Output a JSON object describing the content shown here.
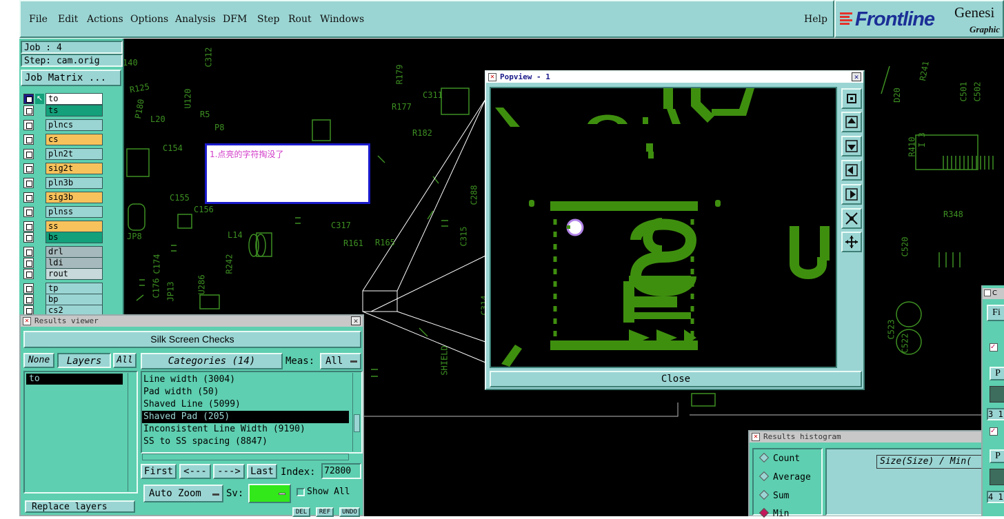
{
  "menu": {
    "items": [
      "File",
      "Edit",
      "Actions",
      "Options",
      "Analysis",
      "DFM",
      "Step",
      "Rout",
      "Windows"
    ],
    "help": "Help"
  },
  "logo": {
    "brand": "Frontline",
    "product": "Genesi",
    "sub": "Graphic"
  },
  "job": {
    "job_label": "Job : 4",
    "step_label": "Step: cam.orig",
    "matrix_button": "Job Matrix ..."
  },
  "layers": [
    {
      "name": "to",
      "color": "#ffffff"
    },
    {
      "name": "ts",
      "color": "#13a07a"
    },
    {
      "name": "plncs",
      "color": "#9ad5d3"
    },
    {
      "name": "cs",
      "color": "#f7c25b"
    },
    {
      "name": "pln2t",
      "color": "#9ad5d3"
    },
    {
      "name": "sig2t",
      "color": "#f7c25b"
    },
    {
      "name": "pln3b",
      "color": "#9ad5d3"
    },
    {
      "name": "sig3b",
      "color": "#f7c25b"
    },
    {
      "name": "plnss",
      "color": "#9ad5d3"
    },
    {
      "name": "ss",
      "color": "#f7c25b"
    },
    {
      "name": "bs",
      "color": "#13a07a"
    },
    {
      "name": "drl",
      "color": "#a6b9bc"
    },
    {
      "name": "ldi",
      "color": "#a6b9bc"
    },
    {
      "name": "rout",
      "color": "#c7d9da"
    },
    {
      "name": "tp",
      "color": "#9ad5d3"
    },
    {
      "name": "bp",
      "color": "#9ad5d3"
    },
    {
      "name": "cs2",
      "color": "#9ad5d3"
    }
  ],
  "annotation": {
    "text": "1.点亮的字符掏没了"
  },
  "results_viewer": {
    "title": "Results viewer",
    "checks_button": "Silk Screen Checks",
    "none_button": "None",
    "layers_label": "Layers",
    "all_button": "All",
    "layer_list": [
      "to"
    ],
    "categories_label": "Categories (14)",
    "meas_label": "Meas:",
    "meas_value": "All",
    "categories": [
      "Line width (3004)",
      "Pad width (50)",
      "Shaved Line (5099)",
      "Shaved Pad (205)",
      "Inconsistent Line Width (9190)",
      "SS to SS spacing (8847)"
    ],
    "selected_category_index": 3,
    "nav": {
      "first": "First",
      "prev": "<---",
      "next": "--->",
      "last": "Last",
      "index_label": "Index:",
      "index_value": "72800"
    },
    "auto_zoom": "Auto Zoom",
    "sv_label": "Sv:",
    "show_all": "Show All",
    "replace_layers": "Replace layers",
    "del": "DEL",
    "ref": "REF",
    "undo": "UNDO"
  },
  "popview": {
    "title": "Popview - 1",
    "close_button": "Close",
    "side_buttons": [
      "zoom-fit-icon",
      "pan-up-icon",
      "pan-down-icon",
      "pan-left-icon",
      "pan-right-icon",
      "zoom-in-icon",
      "zoom-out-icon"
    ]
  },
  "histogram": {
    "title": "Results histogram",
    "options": [
      "Count",
      "Average",
      "Sum",
      "Min"
    ],
    "selected": "Min",
    "field": "Size(Size) / Min("
  },
  "right_window": {
    "title_fragment": "C",
    "button_fragment": "Fi",
    "p1": "P",
    "v1": "3 1",
    "p2": "P",
    "v2": "4 1"
  },
  "pcb_labels": [
    "140",
    "R125",
    "P180",
    "U120",
    "R5",
    "P8",
    "L20",
    "C154",
    "C155",
    "C156",
    "JP8",
    "C174",
    "C176",
    "JP13",
    "U286",
    "R242",
    "C312",
    "C311",
    "R177",
    "R179",
    "R182",
    "C315",
    "C317",
    "R165",
    "R161",
    "L14",
    "SHIELD",
    "C288",
    "C314",
    "D20",
    "R241",
    "C520",
    "R348",
    "C501",
    "C502",
    "C523",
    "C522",
    "R410",
    "I 3"
  ],
  "colors": {
    "pcb_green": "#3d8f22",
    "feature_green": "#3f8f0f",
    "panel_teal": "#5ecfb0",
    "light_teal": "#9ad5d3"
  }
}
